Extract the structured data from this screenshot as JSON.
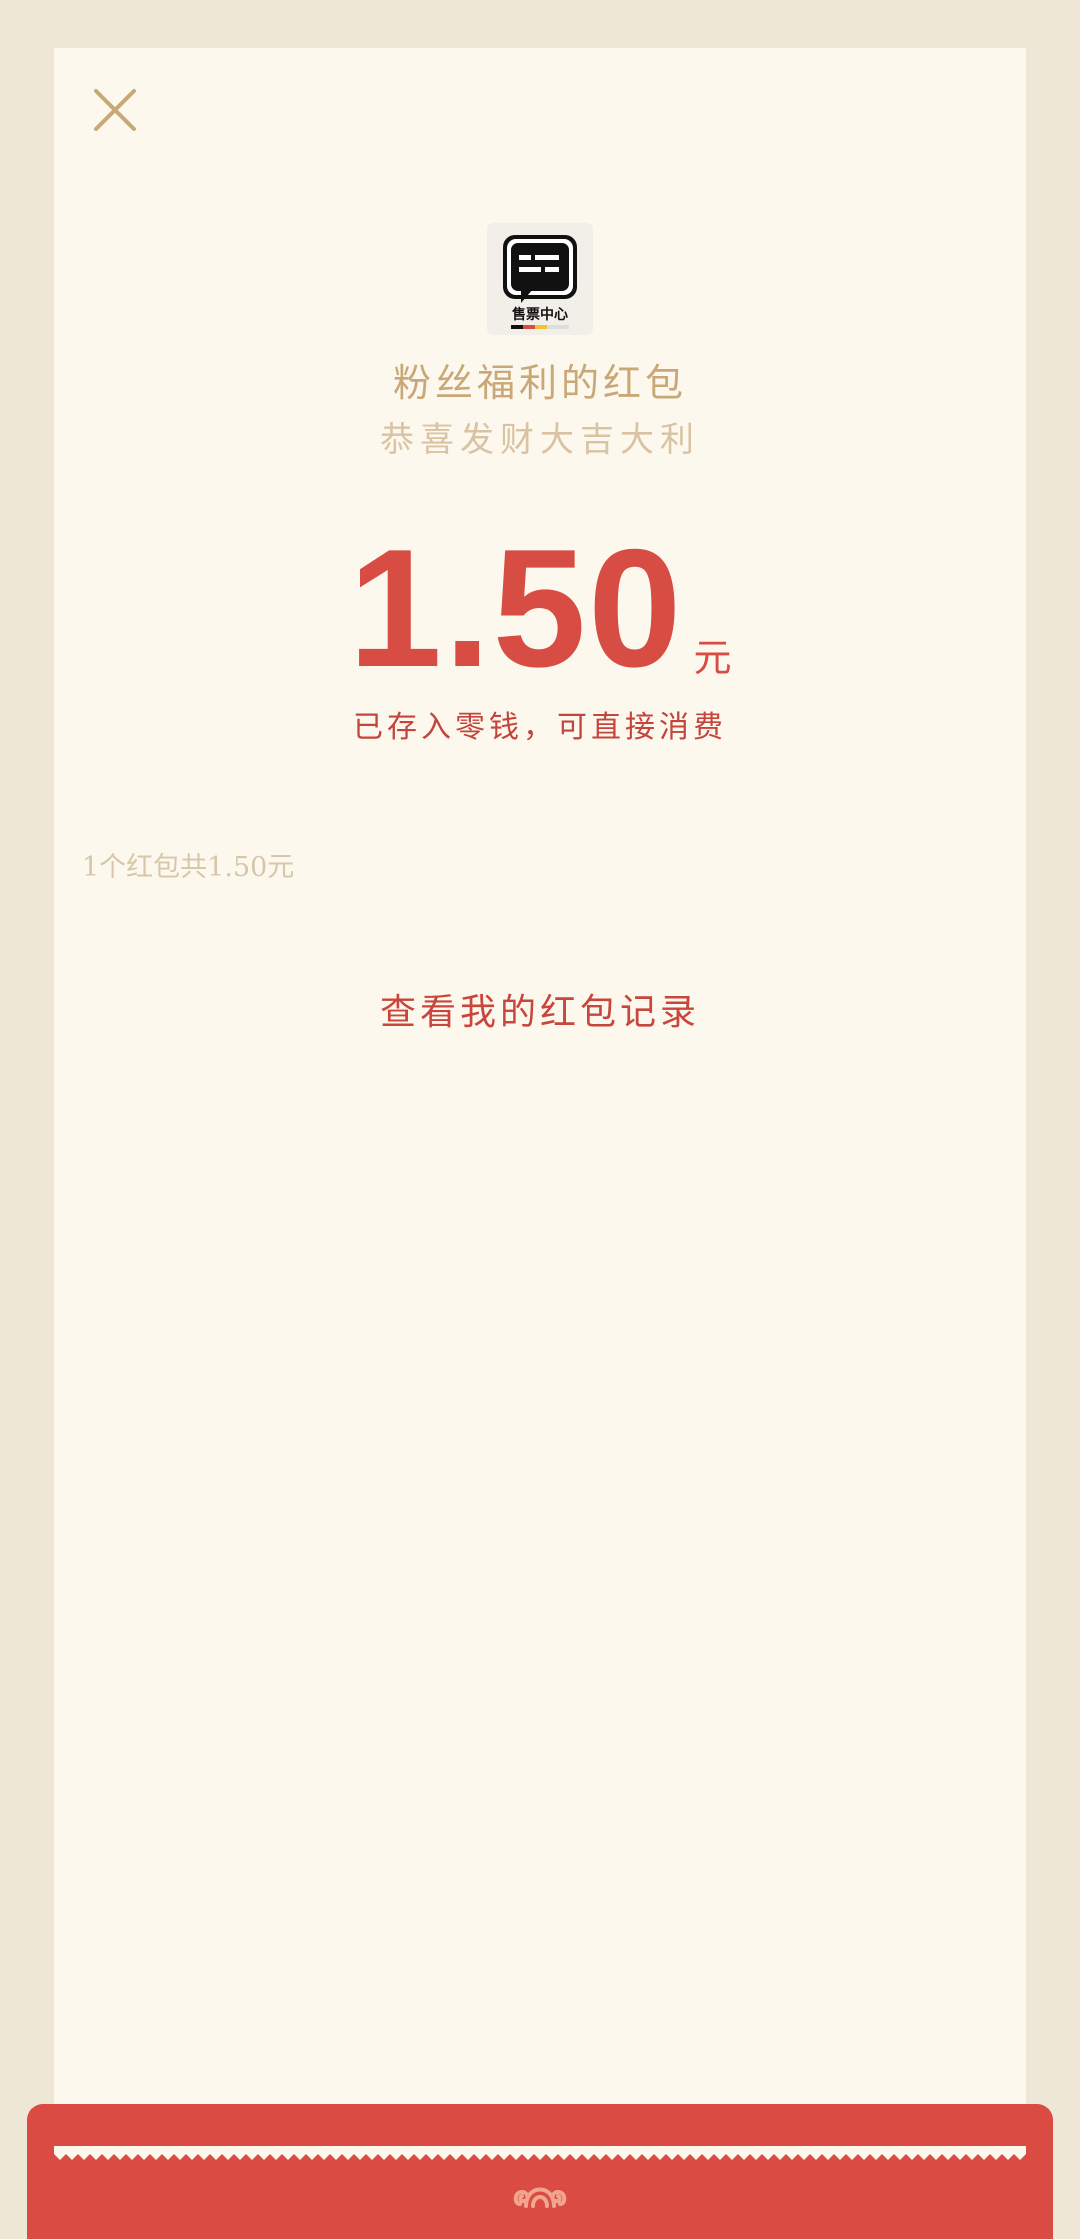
{
  "header": {
    "close_icon": "close-icon"
  },
  "logo": {
    "icon": "chat-bubble-icon",
    "caption": "售票中心"
  },
  "sender": {
    "title": "粉丝福利的红包",
    "greeting": "恭喜发财大吉大利"
  },
  "amount": {
    "value": "1.50",
    "unit": "元",
    "note": "已存入零钱，可直接消费"
  },
  "summary": {
    "text": "1个红包共1.50元"
  },
  "actions": {
    "history_link": "查看我的红包记录"
  },
  "footer": {
    "emblem_icon": "cloud-swirl-icon"
  },
  "colors": {
    "background": "#efe7d6",
    "card": "#fdf8ee",
    "gold": "#c9a878",
    "red": "#d84d43"
  }
}
